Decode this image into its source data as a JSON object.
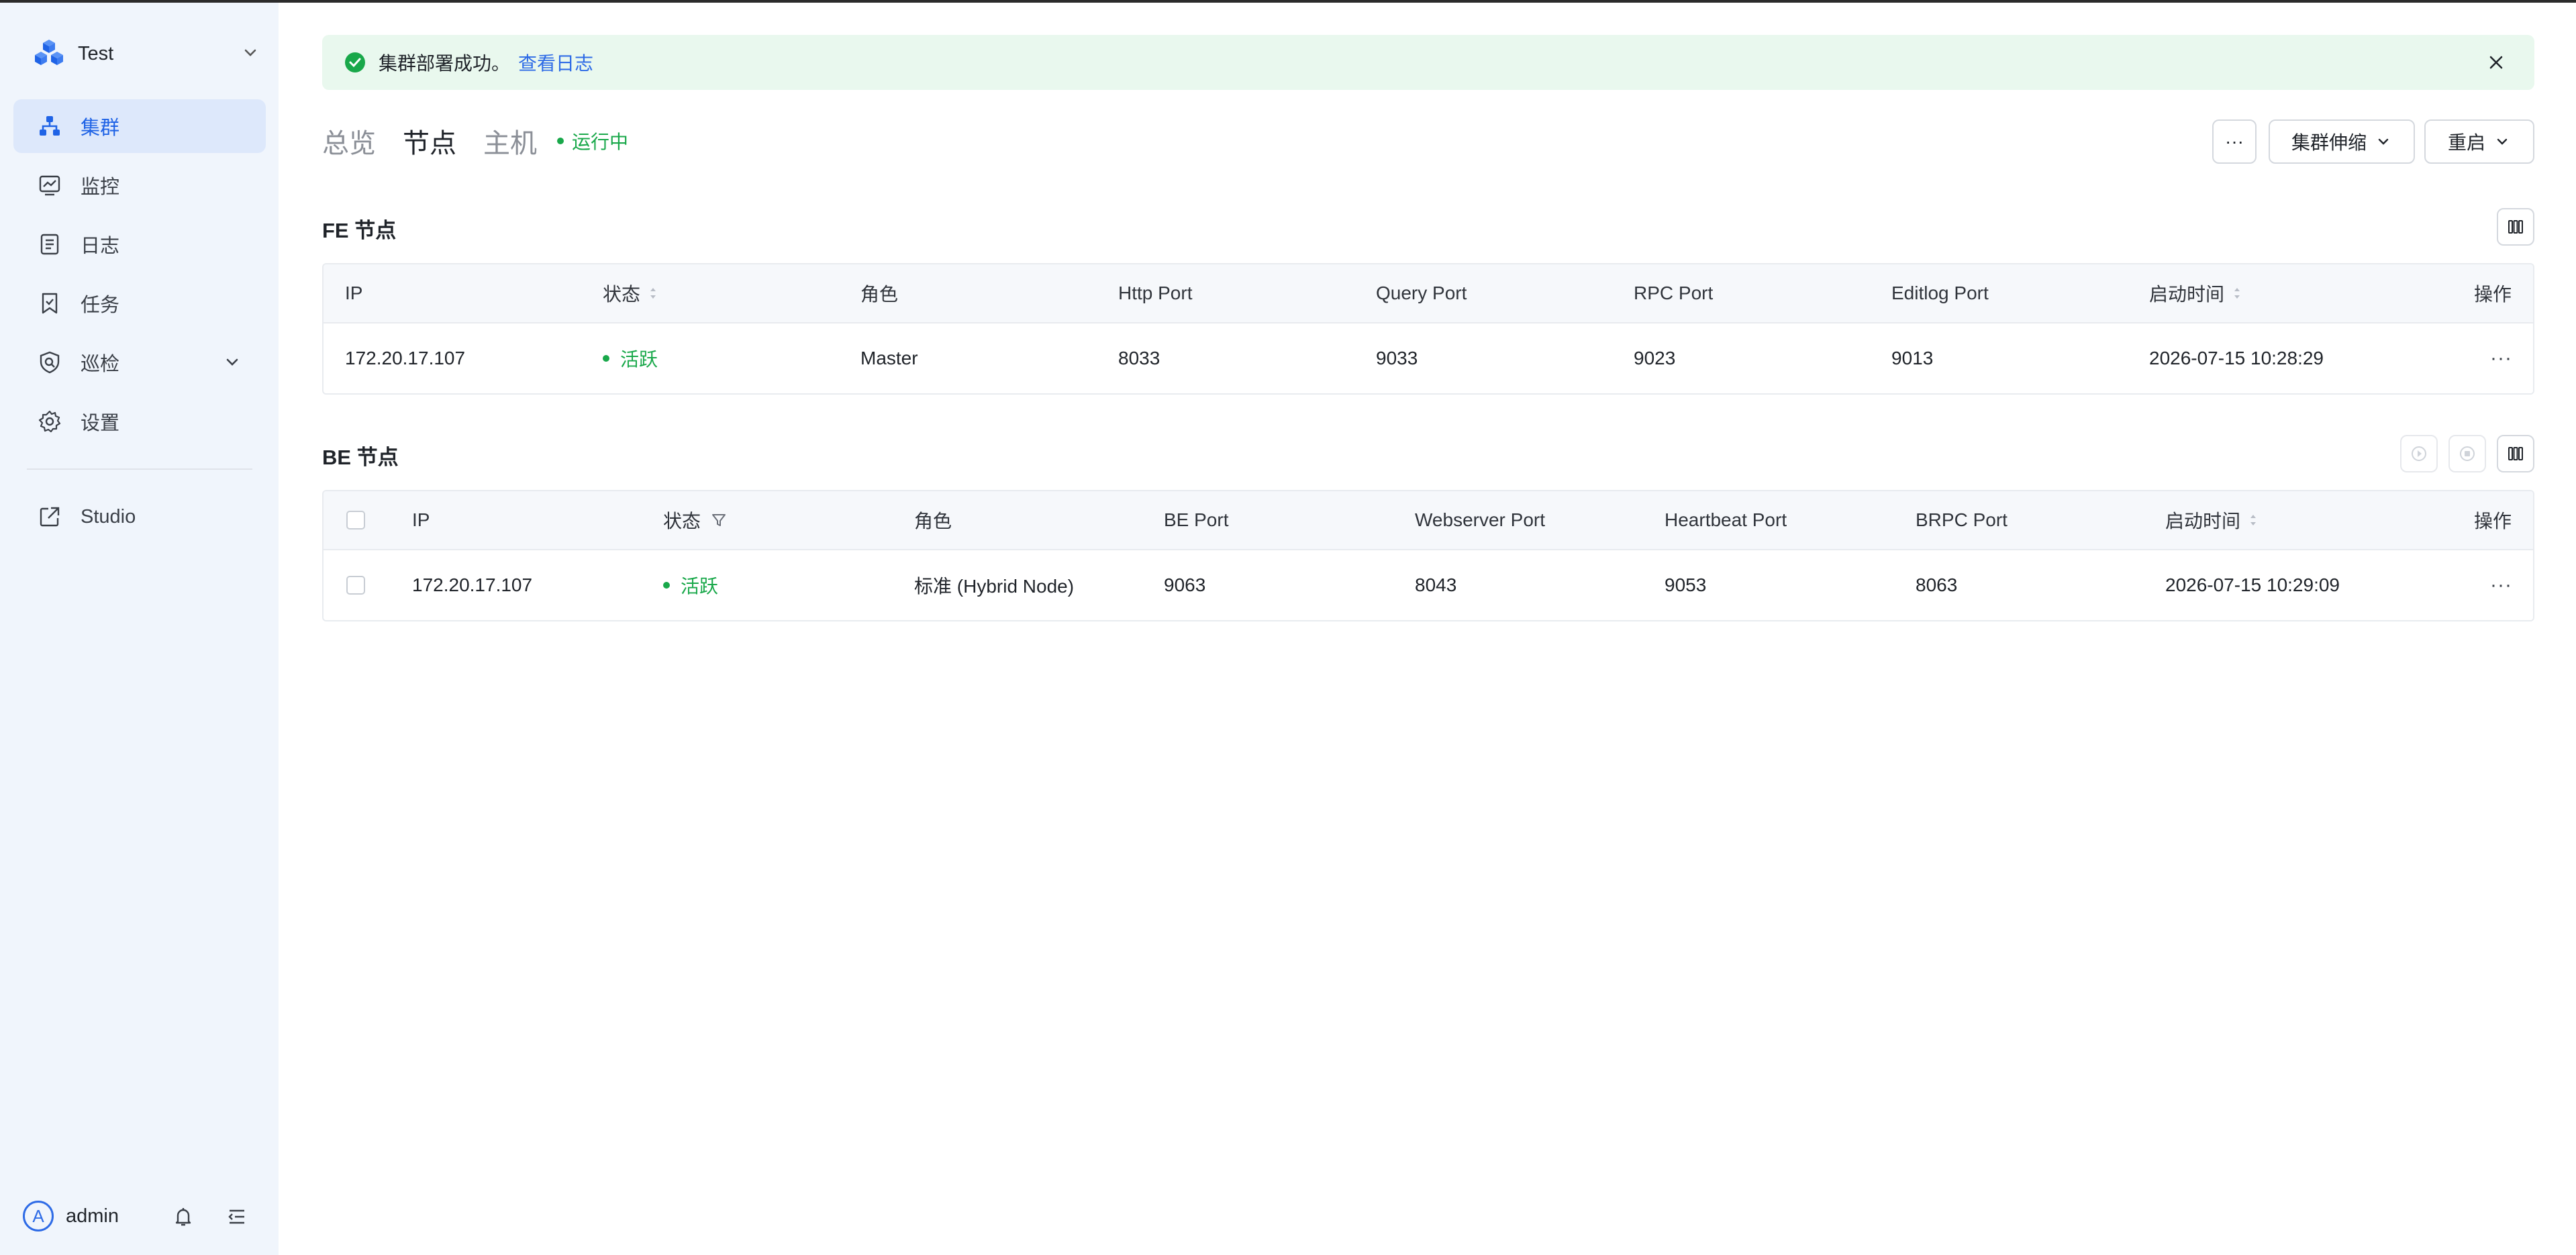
{
  "sidebar": {
    "cluster_name": "Test",
    "items": [
      {
        "label": "集群",
        "icon": "cluster-icon",
        "active": true
      },
      {
        "label": "监控",
        "icon": "monitor-icon"
      },
      {
        "label": "日志",
        "icon": "log-icon"
      },
      {
        "label": "任务",
        "icon": "task-icon"
      },
      {
        "label": "巡检",
        "icon": "inspection-icon",
        "expandable": true
      },
      {
        "label": "设置",
        "icon": "gear-icon"
      }
    ],
    "studio_label": "Studio",
    "user": {
      "avatar_letter": "A",
      "name": "admin"
    }
  },
  "alert": {
    "message": "集群部署成功。",
    "link": "查看日志"
  },
  "tabs": [
    {
      "label": "总览"
    },
    {
      "label": "节点",
      "active": true
    },
    {
      "label": "主机"
    }
  ],
  "cluster_status": "运行中",
  "toolbar": {
    "more_label": "···",
    "scale_label": "集群伸缩",
    "restart_label": "重启"
  },
  "fe": {
    "title": "FE 节点",
    "columns": [
      "IP",
      "状态",
      "角色",
      "Http Port",
      "Query Port",
      "RPC Port",
      "Editlog Port",
      "启动时间",
      "操作"
    ],
    "rows": [
      {
        "ip": "172.20.17.107",
        "status": "活跃",
        "role": "Master",
        "http_port": "8033",
        "query_port": "9033",
        "rpc_port": "9023",
        "editlog_port": "9013",
        "start_time": "2026-07-15 10:28:29",
        "action": "···"
      }
    ]
  },
  "be": {
    "title": "BE 节点",
    "columns": [
      "IP",
      "状态",
      "角色",
      "BE Port",
      "Webserver Port",
      "Heartbeat Port",
      "BRPC Port",
      "启动时间",
      "操作"
    ],
    "rows": [
      {
        "ip": "172.20.17.107",
        "status": "活跃",
        "role": "标准 (Hybrid Node)",
        "be_port": "9063",
        "webserver_port": "8043",
        "heartbeat_port": "9053",
        "brpc_port": "8063",
        "start_time": "2026-07-15 10:29:09",
        "action": "···"
      }
    ]
  },
  "colors": {
    "accent": "#2e6be6",
    "success": "#19a84a",
    "sidebar_bg": "#f0f5fc",
    "alert_bg": "#e9f8ee"
  }
}
